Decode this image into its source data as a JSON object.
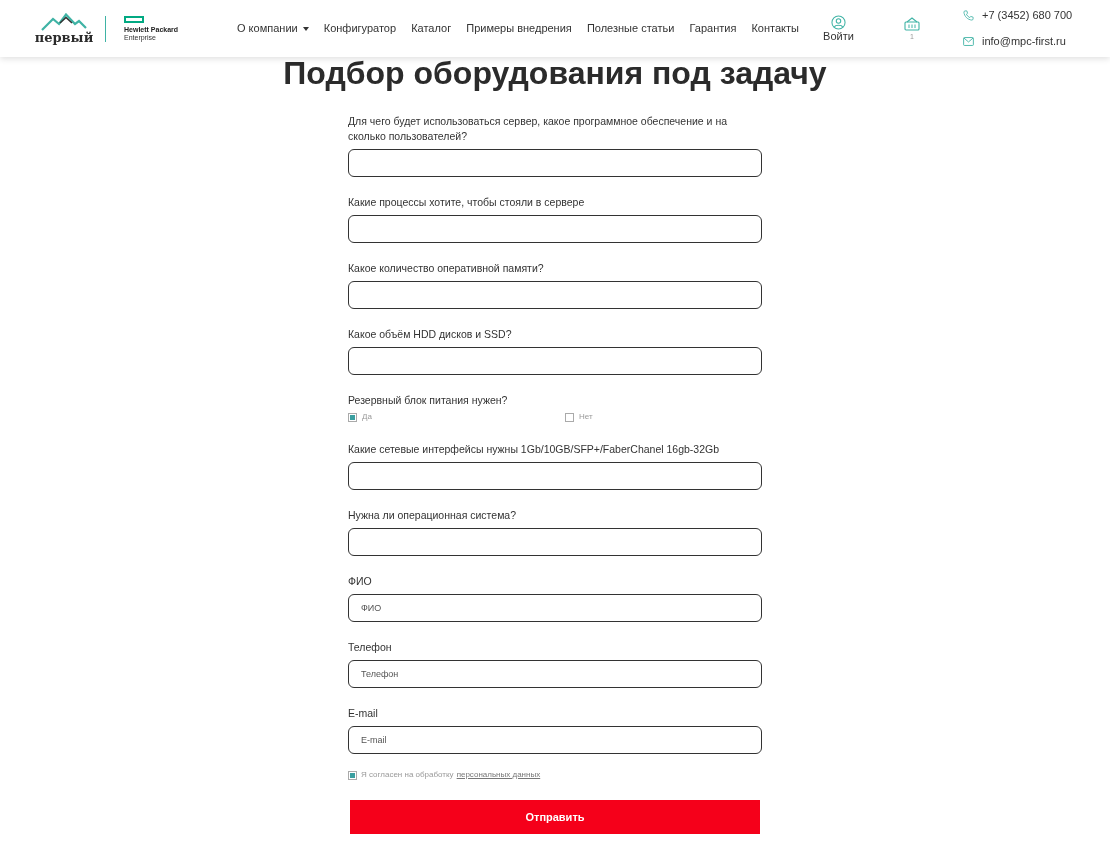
{
  "header": {
    "logo": {
      "wordmark": "первый"
    },
    "partner_logo": {
      "line_1": "Hewlett Packard",
      "line_2": "Enterprise"
    },
    "nav": [
      {
        "label": "О компании",
        "dropdown": true
      },
      {
        "label": "Конфигуратор",
        "dropdown": false
      },
      {
        "label": "Каталог",
        "dropdown": false
      },
      {
        "label": "Примеры внедрения",
        "dropdown": false
      },
      {
        "label": "Полезные статьи",
        "dropdown": false
      },
      {
        "label": "Гарантия",
        "dropdown": false
      },
      {
        "label": "Контакты",
        "dropdown": false
      }
    ],
    "login": {
      "label": "Войти"
    },
    "cart": {
      "count": "1"
    },
    "phone": "+7 (3452) 680 700",
    "email": "info@mpc-first.ru"
  },
  "title": "Подбор оборудования под задачу",
  "form": {
    "fields": [
      {
        "kind": "input",
        "label": "Для чего будет использоваться сервер, какое программное обеспечение и на сколько пользователей?"
      },
      {
        "kind": "input",
        "label": "Какие процессы хотите, чтобы стояли в сервере"
      },
      {
        "kind": "input",
        "label": "Какое количество оперативной памяти?"
      },
      {
        "kind": "input",
        "label": "Какое объём HDD дисков и SSD?"
      },
      {
        "kind": "choice",
        "label": "Резервный блок питания нужен?",
        "options": [
          {
            "label": "Да",
            "checked": true
          },
          {
            "label": "Нет",
            "checked": false
          }
        ]
      },
      {
        "kind": "input",
        "label": "Какие сетевые интерфейсы нужны 1Gb/10GB/SFP+/FaberChanel 16gb-32Gb"
      },
      {
        "kind": "input",
        "label": "Нужна ли операционная система?"
      },
      {
        "kind": "input",
        "label": "ФИО",
        "placeholder": "ФИО"
      },
      {
        "kind": "input",
        "label": "Телефон",
        "placeholder": "Телефон"
      },
      {
        "kind": "input",
        "label": "E-mail",
        "placeholder": "E-mail"
      }
    ],
    "consent": {
      "checked": true,
      "text": "Я согласен на обработку",
      "link": "персональных данных"
    },
    "submit": {
      "label": "Отправить"
    }
  }
}
